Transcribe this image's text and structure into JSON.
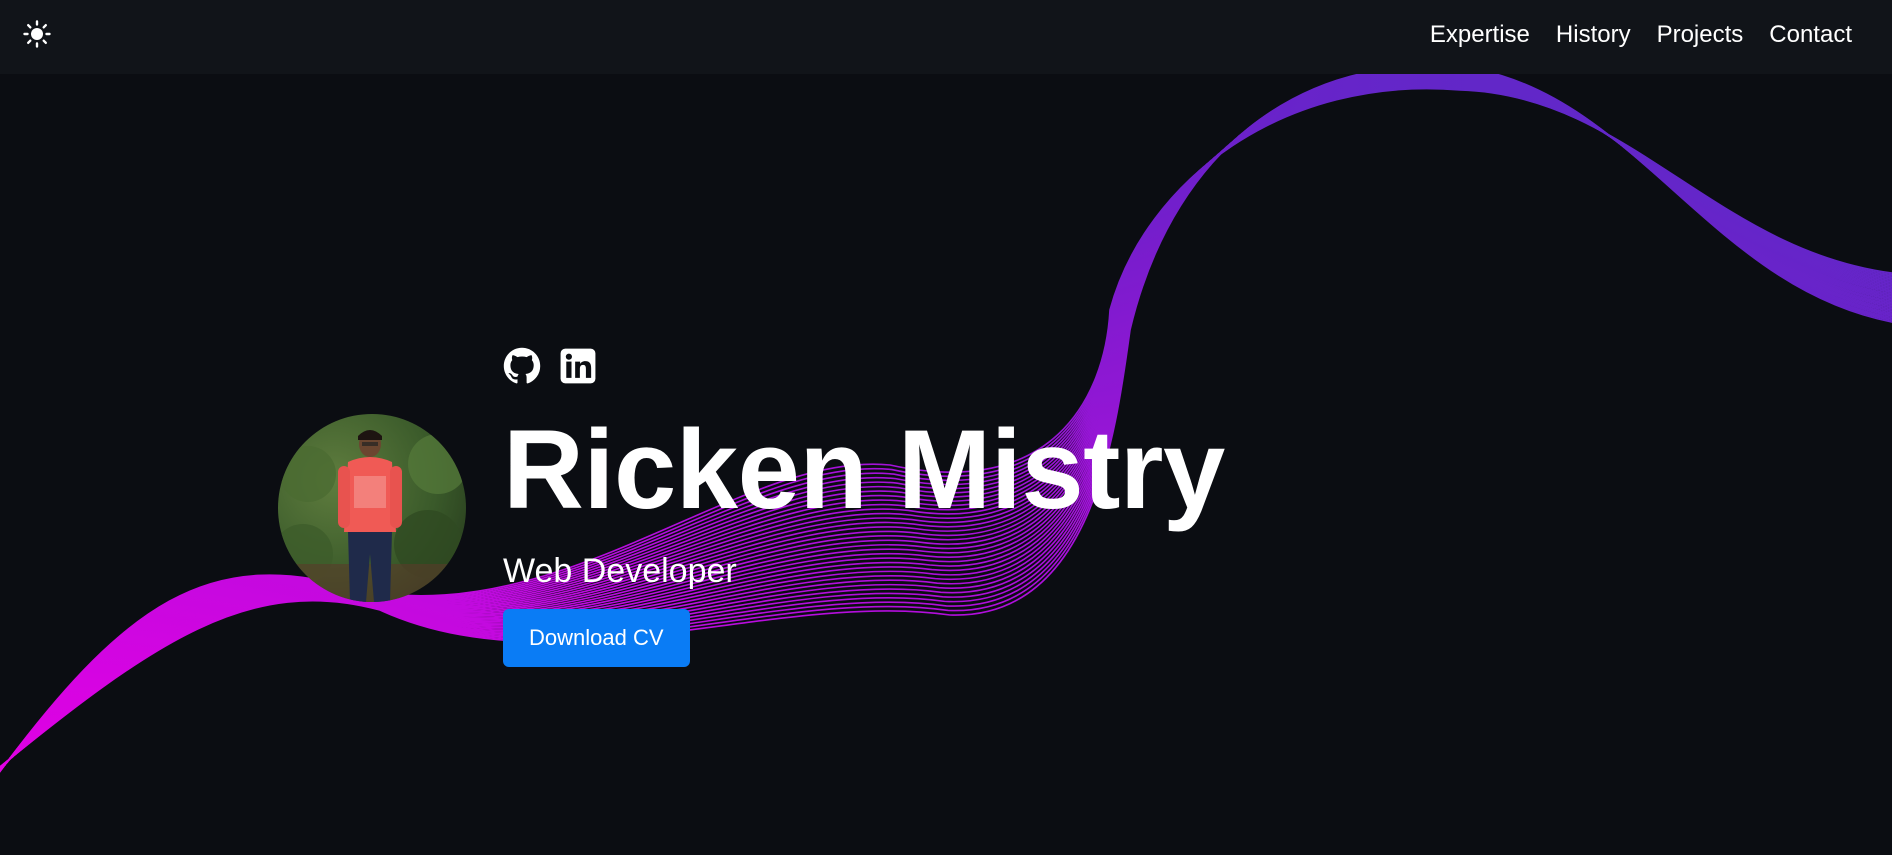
{
  "header": {
    "theme_toggle_icon": "sun-icon",
    "nav": [
      {
        "label": "Expertise"
      },
      {
        "label": "History"
      },
      {
        "label": "Projects"
      },
      {
        "label": "Contact"
      }
    ]
  },
  "hero": {
    "social_icons": [
      "github-icon",
      "linkedin-icon"
    ],
    "name": "Ricken Mistry",
    "title": "Web Developer",
    "cta_label": "Download CV",
    "avatar_alt": "profile photo"
  },
  "colors": {
    "background": "#0b0d12",
    "navbar": "#111419",
    "accent_button": "#0a7cf5",
    "wave_magenta": "#ee00f0",
    "wave_purple": "#7a1fd6",
    "wave_violet": "#5b2fd0"
  }
}
